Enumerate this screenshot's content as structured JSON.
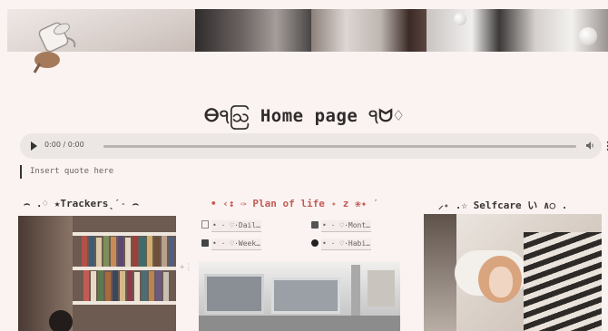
{
  "page": {
    "title": "ⴱ੧ဩ Home page ੧ᗢ♢",
    "quote_placeholder": "Insert quote here"
  },
  "audio_player": {
    "time": "0:00 / 0:00"
  },
  "columns": [
    {
      "heading": "⌢ .♢ ★Trackersˎˊ˗ ⌢",
      "image": "bookshelf-photo"
    },
    {
      "heading": "• ‹↕ ✑ Plan of life ˖ z ❀✦ ˊ",
      "color": "#c25b55",
      "links": [
        {
          "label": "• · ♡·Dail…",
          "icon": "page-icon"
        },
        {
          "label": "• · ♡·Mont…",
          "icon": "folder-icon"
        },
        {
          "label": "• · ♡·Week…",
          "icon": "lock-icon"
        },
        {
          "label": "• · ♡·Habi…",
          "icon": "dark-icon"
        }
      ],
      "image": "train-photo"
    },
    {
      "heading": "⸝˖ .☆ Selfcare い ∧○ .",
      "image": "selfcare-photo"
    }
  ]
}
